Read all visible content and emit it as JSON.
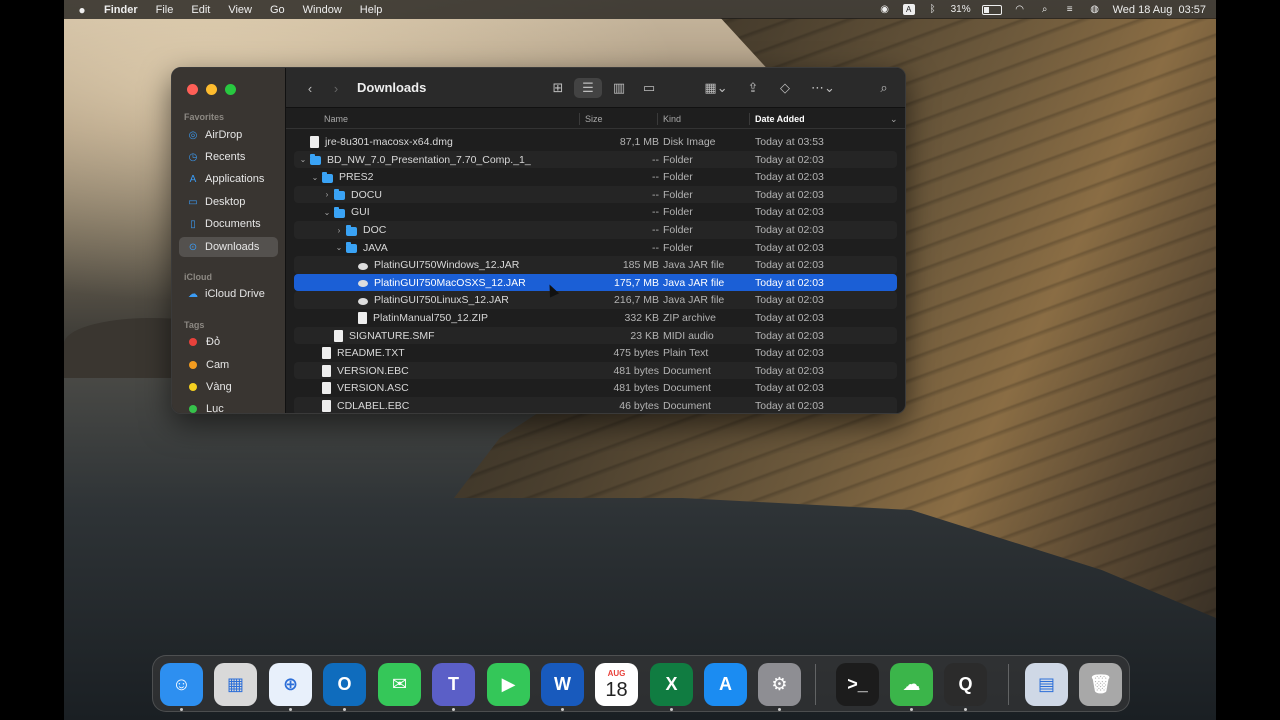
{
  "menubar": {
    "app_name": "Finder",
    "menus": [
      "File",
      "Edit",
      "View",
      "Go",
      "Window",
      "Help"
    ],
    "keyboard_input": "A",
    "battery_percent": "31%",
    "battery_level": 0.31,
    "datetime": "Wed 18 Aug  03:57"
  },
  "finder": {
    "title": "Downloads",
    "sidebar": {
      "favorites_header": "Favorites",
      "favorites": [
        {
          "label": "AirDrop",
          "icon": "airdrop-icon"
        },
        {
          "label": "Recents",
          "icon": "clock-icon"
        },
        {
          "label": "Applications",
          "icon": "applications-icon"
        },
        {
          "label": "Desktop",
          "icon": "desktop-icon"
        },
        {
          "label": "Documents",
          "icon": "document-icon"
        },
        {
          "label": "Downloads",
          "icon": "download-icon"
        }
      ],
      "icloud_header": "iCloud",
      "icloud": [
        {
          "label": "iCloud Drive",
          "icon": "cloud-icon"
        }
      ],
      "tags_header": "Tags",
      "tags": [
        {
          "label": "Đỏ",
          "color": "#e8413b"
        },
        {
          "label": "Cam",
          "color": "#f39c1f"
        },
        {
          "label": "Vàng",
          "color": "#f5d020"
        },
        {
          "label": "Lục",
          "color": "#36c24b"
        }
      ]
    },
    "columns": {
      "name": "Name",
      "size": "Size",
      "kind": "Kind",
      "date": "Date Added"
    },
    "files": [
      {
        "name": "jre-8u301-macosx-x64.dmg",
        "size": "87,1 MB",
        "kind": "Disk Image",
        "date": "Today at 03:53",
        "indent": 0,
        "icon": "doc",
        "chevron": ""
      },
      {
        "name": "BD_NW_7.0_Presentation_7.70_Comp._1_",
        "size": "--",
        "kind": "Folder",
        "date": "Today at 02:03",
        "indent": 0,
        "icon": "folder",
        "chevron": "open"
      },
      {
        "name": "PRES2",
        "size": "--",
        "kind": "Folder",
        "date": "Today at 02:03",
        "indent": 1,
        "icon": "folder",
        "chevron": "open"
      },
      {
        "name": "DOCU",
        "size": "--",
        "kind": "Folder",
        "date": "Today at 02:03",
        "indent": 2,
        "icon": "folder",
        "chevron": "closed"
      },
      {
        "name": "GUI",
        "size": "--",
        "kind": "Folder",
        "date": "Today at 02:03",
        "indent": 2,
        "icon": "folder",
        "chevron": "open"
      },
      {
        "name": "DOC",
        "size": "--",
        "kind": "Folder",
        "date": "Today at 02:03",
        "indent": 3,
        "icon": "folder",
        "chevron": "closed"
      },
      {
        "name": "JAVA",
        "size": "--",
        "kind": "Folder",
        "date": "Today at 02:03",
        "indent": 3,
        "icon": "folder",
        "chevron": "open"
      },
      {
        "name": "PlatinGUI750Windows_12.JAR",
        "size": "185 MB",
        "kind": "Java JAR file",
        "date": "Today at 02:03",
        "indent": 4,
        "icon": "jar",
        "chevron": ""
      },
      {
        "name": "PlatinGUI750MacOSXS_12.JAR",
        "size": "175,7 MB",
        "kind": "Java JAR file",
        "date": "Today at 02:03",
        "indent": 4,
        "icon": "jar",
        "chevron": "",
        "selected": true
      },
      {
        "name": "PlatinGUI750LinuxS_12.JAR",
        "size": "216,7 MB",
        "kind": "Java JAR file",
        "date": "Today at 02:03",
        "indent": 4,
        "icon": "jar",
        "chevron": ""
      },
      {
        "name": "PlatinManual750_12.ZIP",
        "size": "332 KB",
        "kind": "ZIP archive",
        "date": "Today at 02:03",
        "indent": 4,
        "icon": "doc",
        "chevron": ""
      },
      {
        "name": "SIGNATURE.SMF",
        "size": "23 KB",
        "kind": "MIDI audio",
        "date": "Today at 02:03",
        "indent": 2,
        "icon": "doc",
        "chevron": ""
      },
      {
        "name": "README.TXT",
        "size": "475 bytes",
        "kind": "Plain Text",
        "date": "Today at 02:03",
        "indent": 1,
        "icon": "doc",
        "chevron": ""
      },
      {
        "name": "VERSION.EBC",
        "size": "481 bytes",
        "kind": "Document",
        "date": "Today at 02:03",
        "indent": 1,
        "icon": "doc",
        "chevron": ""
      },
      {
        "name": "VERSION.ASC",
        "size": "481 bytes",
        "kind": "Document",
        "date": "Today at 02:03",
        "indent": 1,
        "icon": "doc",
        "chevron": ""
      },
      {
        "name": "CDLABEL.EBC",
        "size": "46 bytes",
        "kind": "Document",
        "date": "Today at 02:03",
        "indent": 1,
        "icon": "doc",
        "chevron": ""
      }
    ]
  },
  "dock": {
    "apps": [
      {
        "name": "finder-app",
        "glyph": "☺",
        "bg": "#2d8ff0",
        "running": true
      },
      {
        "name": "launchpad-app",
        "glyph": "▦",
        "bg": "#d9d9d9",
        "running": false
      },
      {
        "name": "safari-app",
        "glyph": "⊕",
        "bg": "#e8f0fb",
        "running": true
      },
      {
        "name": "outlook-app",
        "glyph": "O",
        "bg": "#0f6cbd",
        "running": true
      },
      {
        "name": "messages-app",
        "glyph": "✉",
        "bg": "#35c759",
        "running": false
      },
      {
        "name": "teams-app",
        "glyph": "T",
        "bg": "#5b5fc7",
        "running": true
      },
      {
        "name": "facetime-app",
        "glyph": "▶",
        "bg": "#34c759",
        "running": false
      },
      {
        "name": "word-app",
        "glyph": "W",
        "bg": "#185abd",
        "running": true
      },
      {
        "name": "calendar-app",
        "glyph": "18",
        "bg": "#ffffff",
        "running": false
      },
      {
        "name": "excel-app",
        "glyph": "X",
        "bg": "#107c41",
        "running": true
      },
      {
        "name": "appstore-app",
        "glyph": "A",
        "bg": "#1b8cf2",
        "running": false
      },
      {
        "name": "system-preferences-app",
        "glyph": "⚙",
        "bg": "#8e8e93",
        "running": true
      },
      {
        "name": "terminal-app",
        "glyph": ">_",
        "bg": "#1c1c1c",
        "running": false
      },
      {
        "name": "cloud-app",
        "glyph": "☁",
        "bg": "#3bb54a",
        "running": true
      },
      {
        "name": "quicktime-app",
        "glyph": "Q",
        "bg": "#2b2b2b",
        "running": true
      },
      {
        "name": "downloads-stack",
        "glyph": "▤",
        "bg": "#cfd8e6",
        "running": false
      },
      {
        "name": "trash-app",
        "glyph": "🗑",
        "bg": "#a8a8a8",
        "running": false
      }
    ],
    "calendar_month": "AUG",
    "calendar_day": "18"
  }
}
